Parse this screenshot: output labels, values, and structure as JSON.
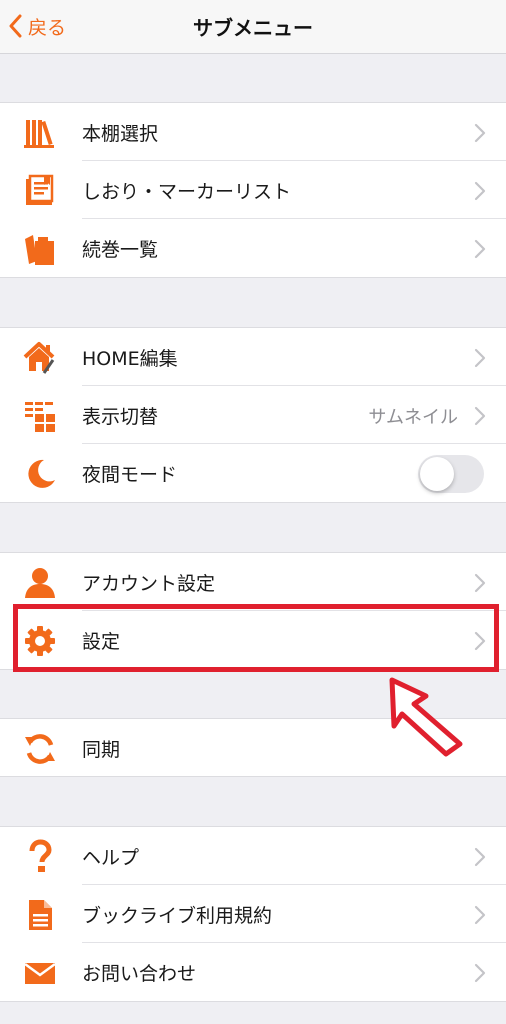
{
  "navbar": {
    "back_label": "戻る",
    "title": "サブメニュー"
  },
  "colors": {
    "accent": "#f26a1b",
    "highlight": "#e0202e",
    "value_text": "#8e8e93"
  },
  "sections": [
    {
      "items": [
        {
          "label": "本棚選択",
          "icon": "bookshelf-icon",
          "chevron": true
        },
        {
          "label": "しおり・マーカーリスト",
          "icon": "bookmark-list-icon",
          "chevron": true
        },
        {
          "label": "続巻一覧",
          "icon": "series-books-icon",
          "chevron": true
        }
      ]
    },
    {
      "items": [
        {
          "label": "HOME編集",
          "icon": "home-edit-icon",
          "chevron": true
        },
        {
          "label": "表示切替",
          "icon": "grid-view-icon",
          "value": "サムネイル",
          "chevron": true
        },
        {
          "label": "夜間モード",
          "icon": "moon-icon",
          "toggle": false
        }
      ]
    },
    {
      "items": [
        {
          "label": "アカウント設定",
          "icon": "user-icon",
          "chevron": true
        },
        {
          "label": "設定",
          "icon": "gear-icon",
          "chevron": true
        }
      ]
    },
    {
      "items": [
        {
          "label": "同期",
          "icon": "sync-icon"
        }
      ]
    },
    {
      "items": [
        {
          "label": "ヘルプ",
          "icon": "help-icon",
          "chevron": true
        },
        {
          "label": "ブックライブ利用規約",
          "icon": "document-icon",
          "chevron": true
        },
        {
          "label": "お問い合わせ",
          "icon": "mail-icon",
          "chevron": true
        }
      ]
    }
  ]
}
